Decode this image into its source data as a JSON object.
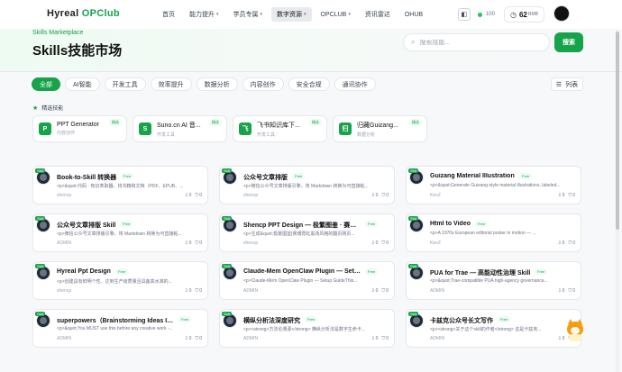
{
  "header": {
    "logo_prefix": "Hyreal ",
    "logo_accent": "OPClub",
    "nav": [
      {
        "label": "首页",
        "dropdown": false
      },
      {
        "label": "能力提升",
        "dropdown": true
      },
      {
        "label": "学员专属",
        "dropdown": true
      },
      {
        "label": "数字资源",
        "dropdown": true,
        "active": true
      },
      {
        "label": "OPCLUB",
        "dropdown": true
      },
      {
        "label": "资讯雷达",
        "dropdown": false
      },
      {
        "label": "OHUB",
        "dropdown": false
      }
    ],
    "points": "100",
    "credits": "62",
    "credits_unit": "RMB"
  },
  "hero": {
    "subtitle": "Skills Marketplace",
    "title": "Skills技能市场",
    "search_placeholder": "搜索技能...",
    "search_button": "搜索"
  },
  "filters": [
    "全部",
    "AI智能",
    "开发工具",
    "效率提升",
    "数据分析",
    "内容创作",
    "安全合规",
    "通讯协作"
  ],
  "active_filter": "全部",
  "view_toggle": "列表",
  "featured_title": "精选技能",
  "featured_badge": "精选",
  "featured": [
    {
      "icon": "P",
      "name": "PPT Generator",
      "category": "内容创作"
    },
    {
      "icon": "S",
      "name": "Suno.cn AI 音...",
      "category": "开发工具"
    },
    {
      "icon": "飞",
      "name": "飞书知识库下...",
      "category": "开发工具"
    },
    {
      "icon": "归",
      "name": "归藏Guizang...",
      "category": "数据分析"
    }
  ],
  "card_tag": "Skill",
  "free_label": "Free",
  "skills": [
    {
      "title": "Book-to-Skill 转换器",
      "desc": "<p>&quot;代码 · 知识萃取器。将书籍和文档（PDF、EPUB、...",
      "author": "shencp",
      "downloads": "0",
      "stars": "0"
    },
    {
      "title": "公众号文章排版",
      "desc": "<p>微信公众号文章排版引擎。将 Markdown 转换为可直接粘...",
      "author": "shencp",
      "downloads": "0",
      "stars": "0"
    },
    {
      "title": "Guizang Material Illustration",
      "desc": "<p>&quot;Generate Guizang-style material illustrations, labeled...",
      "author": "KenZ",
      "downloads": "0",
      "stars": "0"
    },
    {
      "title": "公众号文章排版 Skill",
      "desc": "<p>微信公众号文章排版引擎。将 Markdown 转换为可直接粘...",
      "author": "ADMIN",
      "downloads": "0",
      "stars": "0"
    },
    {
      "title": "Shencp PPT Design — 极繁图鉴 · 赛博霓虹黑...",
      "desc": "<p>生成&quot;极繁图鉴|赛博霓虹黑场风格的翻页网页...",
      "author": "shencp",
      "downloads": "0",
      "stars": "0"
    },
    {
      "title": "Html to Video",
      "desc": "<p>A 1970s European editorial poster in motion — ...",
      "author": "KenZ",
      "downloads": "0",
      "stars": "0"
    },
    {
      "title": "Hyreal Ppt Design",
      "desc": "<p>创建具有鲜明个性、达到生产级质量且具备高水准的...",
      "author": "shencp",
      "downloads": "0",
      "stars": "0"
    },
    {
      "title": "Claude-Mem OpenClaw Plugin — Setup Gui...",
      "desc": "<p>Claude-Mem OpenClaw Plugin — Setup GuideThis...",
      "author": "ADMIN",
      "downloads": "0",
      "stars": "0"
    },
    {
      "title": "PUA for Trae — 高能动性治理 Skill",
      "desc": "<p>&quot;Trae-compatible PUA high-agency governance...",
      "author": "ADMIN",
      "downloads": "0",
      "stars": "0"
    },
    {
      "title": "superpowers（Brainstorming Ideas Into De...",
      "desc": "<p>&quot;You MUST use this before any creative work -...",
      "author": "ADMIN",
      "downloads": "0",
      "stars": "0"
    },
    {
      "title": "横纵分析法深度研究",
      "desc": "<p><strong>方法论溯源</strong> 横纵分析法是数字生命卡...",
      "author": "ADMIN",
      "downloads": "0",
      "stars": "0"
    },
    {
      "title": "卡兹克公众号长文写作",
      "desc": "<p><strong>关于这个skill的作者</strong> 这是卡兹克...",
      "author": "ADMIN",
      "downloads": "0",
      "stars": "0"
    }
  ]
}
